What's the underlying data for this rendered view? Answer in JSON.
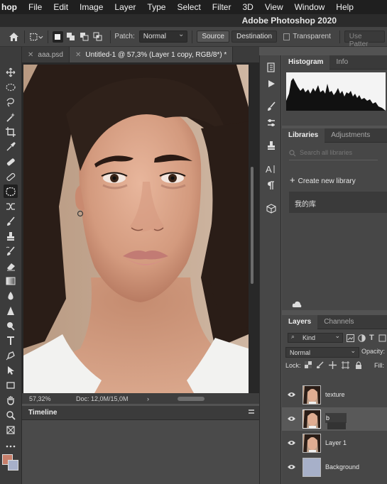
{
  "menubar": {
    "app": "hop",
    "items": [
      "File",
      "Edit",
      "Image",
      "Layer",
      "Type",
      "Select",
      "Filter",
      "3D",
      "View",
      "Window",
      "Help"
    ]
  },
  "titlebar": {
    "title": "Adobe Photoshop 2020"
  },
  "options": {
    "patch_label": "Patch:",
    "patch_mode": "Normal",
    "source_label": "Source",
    "destination_label": "Destination",
    "transparent_label": "Transparent",
    "use_pattern_label": "Use Patter"
  },
  "doc_tabs": [
    {
      "label": "aaa.psd",
      "active": false
    },
    {
      "label": "Untitled-1 @ 57,3% (Layer 1 copy, RGB/8*) *",
      "active": true
    }
  ],
  "status": {
    "zoom": "57,32%",
    "doc": "Doc: 12,0M/15,0M",
    "arrow": "›"
  },
  "timeline": {
    "title": "Timeline"
  },
  "histogram_panel": {
    "tabs": [
      "Histogram",
      "Info"
    ]
  },
  "libraries_panel": {
    "tabs": [
      "Libraries",
      "Adjustments"
    ],
    "search_placeholder": "Search all libraries",
    "create_label": "Create new library",
    "library_name": "我的库"
  },
  "layers_panel": {
    "tabs": [
      "Layers",
      "Channels"
    ],
    "filter_kind": "Kind",
    "blend_mode": "Normal",
    "opacity_label": "Opacity:",
    "lock_label": "Lock:",
    "fill_label": "Fill:",
    "layers": [
      {
        "name": "texture",
        "selected": false,
        "editing": false
      },
      {
        "name": "b",
        "selected": true,
        "editing": true
      },
      {
        "name": "Layer 1",
        "selected": false,
        "editing": false
      },
      {
        "name": "Background",
        "selected": false,
        "editing": false
      }
    ]
  },
  "colors": {
    "foreground": "#c77e6a",
    "background": "#a7b0c9"
  }
}
